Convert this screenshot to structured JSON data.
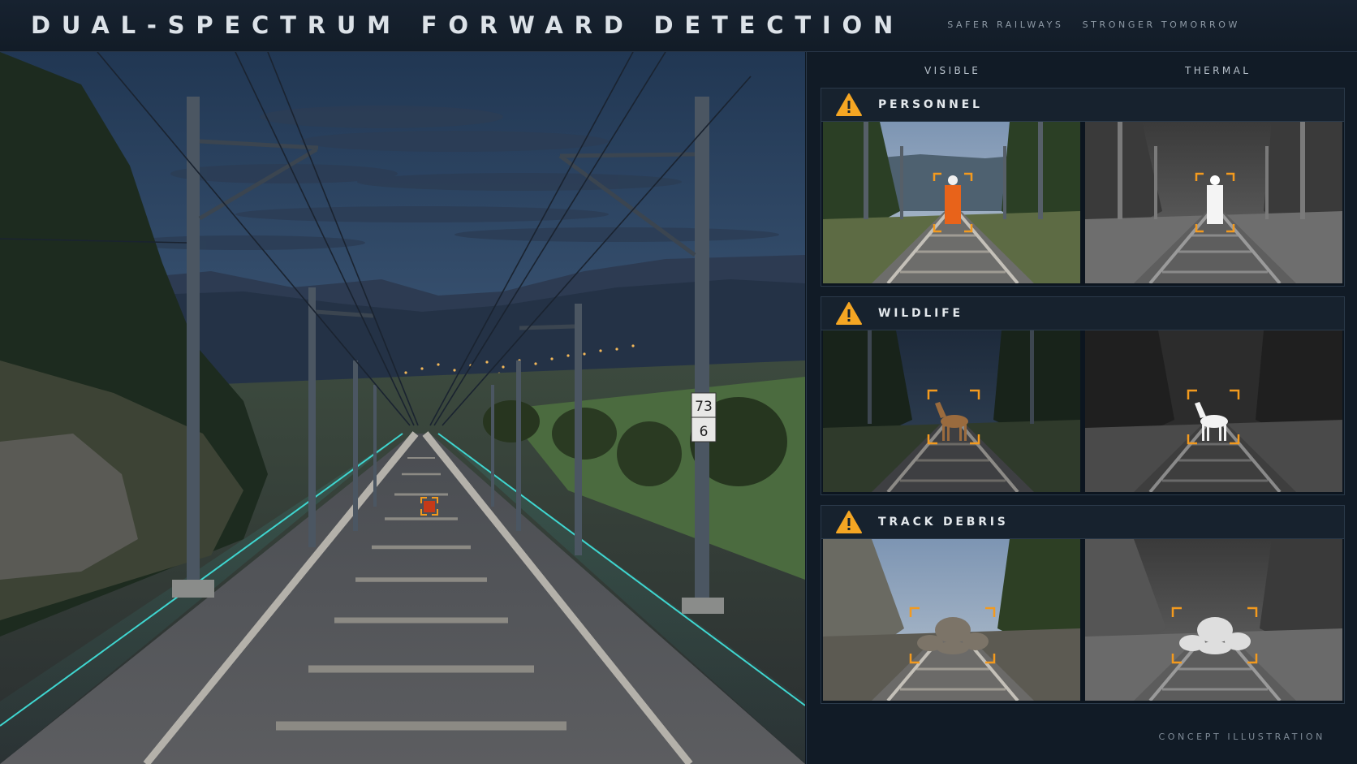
{
  "header": {
    "title": "DUAL-SPECTRUM FORWARD DETECTION",
    "tagline_left": "SAFER RAILWAYS",
    "tagline_right": "STRONGER TOMORROW"
  },
  "main_view": {
    "kilometer_post": {
      "top": "73",
      "bottom": "6"
    },
    "target_box_color": "#f39a1e",
    "guide_line_color": "#3fd6d0"
  },
  "panel": {
    "col_visible": "VISIBLE",
    "col_thermal": "THERMAL",
    "detections": [
      {
        "label": "PERSONNEL",
        "icon": "warning-triangle-icon",
        "subject": "person"
      },
      {
        "label": "WILDLIFE",
        "icon": "warning-triangle-icon",
        "subject": "deer"
      },
      {
        "label": "TRACK DEBRIS",
        "icon": "warning-triangle-icon",
        "subject": "rocks"
      }
    ],
    "warning_color": "#f5a623"
  },
  "footer": {
    "note": "CONCEPT ILLUSTRATION"
  }
}
